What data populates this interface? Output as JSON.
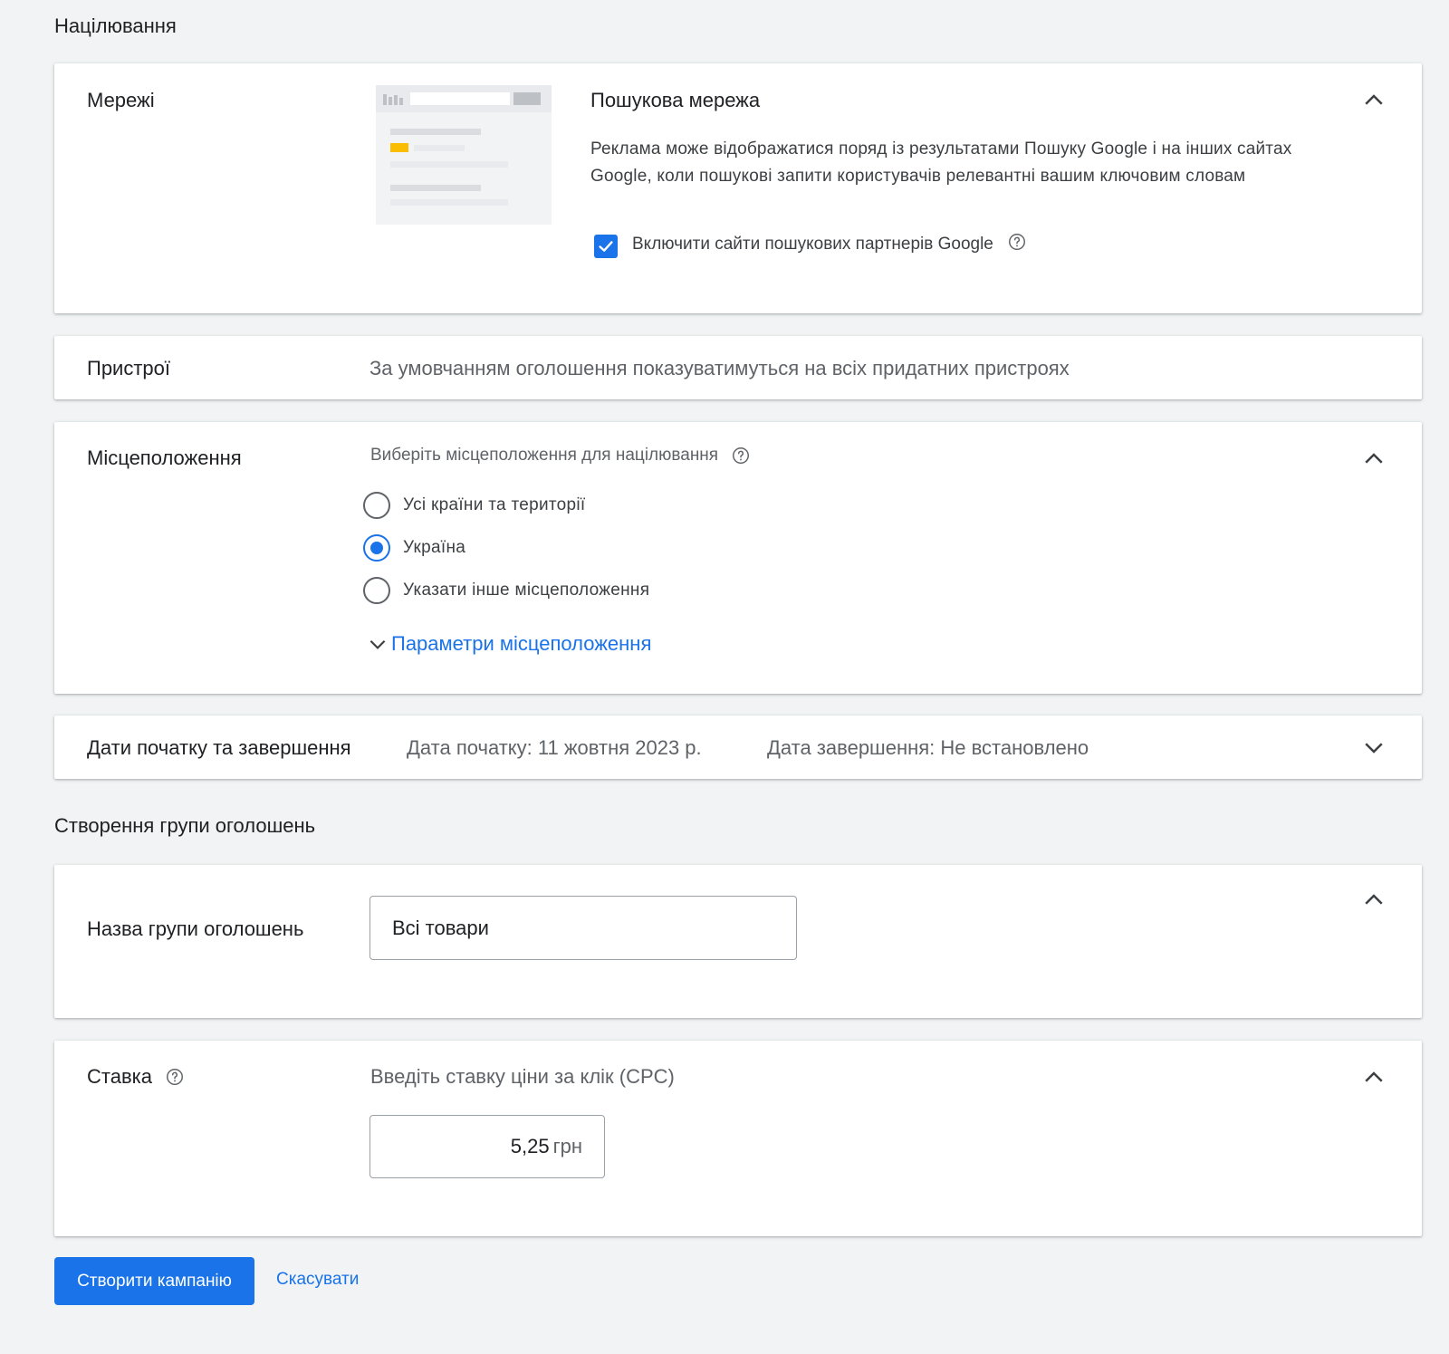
{
  "targeting": {
    "title": "Націлювання",
    "networks": {
      "label": "Мережі",
      "title": "Пошукова мережа",
      "description": "Реклама може відображатися поряд із результатами Пошуку Google і на інших сайтах Google, коли пошукові запити користувачів релевантні вашим ключовим словам",
      "checkbox_label": "Включити сайти пошукових партнерів Google",
      "checkbox_checked": true,
      "icon": "chevron-up-icon"
    },
    "devices": {
      "label": "Пристрої",
      "value": "За умовчанням оголошення показуватимуться на всіх придатних пристроях"
    },
    "locations": {
      "label": "Місцеположення",
      "prompt": "Виберіть місцеположення для націлювання",
      "options": [
        "Усі країни та території",
        "Україна",
        "Указати інше місцеположення"
      ],
      "selected": "Україна",
      "link": "Параметри місцеположення"
    },
    "dates": {
      "label": "Дати початку та завершення",
      "start": "Дата початку: 11 жовтня 2023 р.",
      "end": "Дата завершення: Не встановлено"
    }
  },
  "ad_group": {
    "title": "Створення групи оголошень",
    "name_label": "Назва групи оголошень",
    "name_value": "Всі товари",
    "bid_label": "Ставка",
    "bid_prompt": "Введіть ставку ціни за клік (CPC)",
    "bid_value": "5,25",
    "bid_currency": "грн"
  },
  "actions": {
    "create": "Створити кампанію",
    "cancel": "Скасувати"
  },
  "colors": {
    "accent": "#1a73e8",
    "background": "#f1f3f4",
    "illustration_highlight": "#fbbc04"
  }
}
